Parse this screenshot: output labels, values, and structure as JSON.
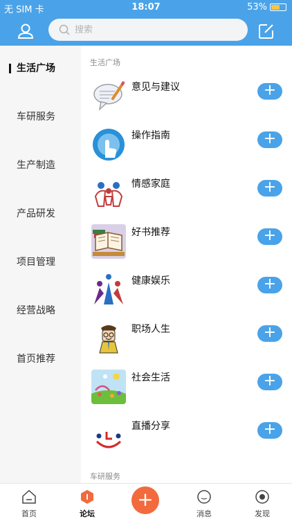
{
  "status_bar": {
    "carrier": "无 SIM 卡",
    "time": "18:07",
    "battery_percent": "53%",
    "battery_level": 0.53
  },
  "search": {
    "placeholder": "搜索"
  },
  "sidebar": {
    "items": [
      {
        "label": "生活广场",
        "active": true
      },
      {
        "label": "车研服务"
      },
      {
        "label": "生产制造"
      },
      {
        "label": "产品研发"
      },
      {
        "label": "项目管理"
      },
      {
        "label": "经营战略"
      },
      {
        "label": "首页推荐"
      }
    ]
  },
  "content": {
    "section_title": "生活广场",
    "next_section_title": "车研服务",
    "forums": [
      {
        "label": "意见与建议",
        "icon": "speech-bubble-pencil-icon"
      },
      {
        "label": "操作指南",
        "icon": "pointing-hand-icon"
      },
      {
        "label": "情感家庭",
        "icon": "family-icon"
      },
      {
        "label": "好书推荐",
        "icon": "book-icon"
      },
      {
        "label": "健康娱乐",
        "icon": "people-ball-icon"
      },
      {
        "label": "职场人生",
        "icon": "office-worker-icon"
      },
      {
        "label": "社会生活",
        "icon": "landscape-icon"
      },
      {
        "label": "直播分享",
        "icon": "smiley-clock-icon"
      }
    ],
    "add_glyph": "+"
  },
  "tabbar": {
    "tabs": [
      {
        "label": "首页"
      },
      {
        "label": "论坛",
        "active": true
      },
      {
        "label": "消息"
      },
      {
        "label": "发现"
      }
    ],
    "fab_glyph": "+"
  },
  "colors": {
    "accent": "#4aa3e8",
    "fab": "#f26a3d",
    "sidebar_bg": "#f6f6f6"
  }
}
